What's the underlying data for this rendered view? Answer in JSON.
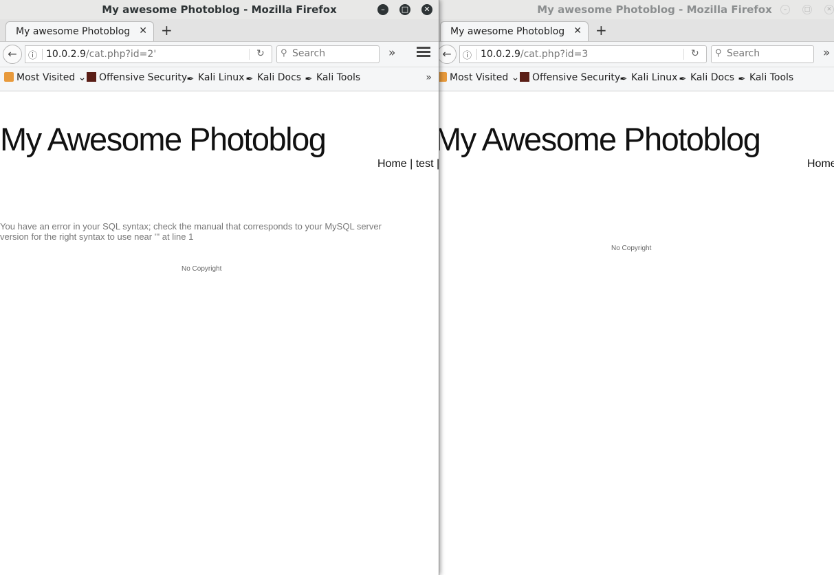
{
  "left": {
    "window_title": "My awesome Photoblog - Mozilla Firefox",
    "window_buttons": {
      "minimize": "–",
      "maximize": "□",
      "close": "✕"
    },
    "tab": {
      "label": "My awesome Photoblog",
      "close": "✕"
    },
    "new_tab": "+",
    "url": {
      "host": "10.0.2.9",
      "path": "/cat.php?id=2'"
    },
    "search_placeholder": "Search",
    "overflow": "»",
    "bookmarks": [
      {
        "label": "Most Visited",
        "icon": "folder-icon"
      },
      {
        "label": "Offensive Security",
        "icon": "offsec-icon"
      },
      {
        "label": "Kali Linux",
        "icon": "kali-icon"
      },
      {
        "label": "Kali Docs",
        "icon": "kali-icon"
      },
      {
        "label": "Kali Tools",
        "icon": "kali-icon"
      }
    ],
    "bookmarks_more": "»",
    "site_title": "My Awesome Photoblog",
    "nav": "Home |  test |",
    "sql_error": "You have an error in your SQL syntax; check the manual that corresponds to your MySQL server version for the right syntax to use near ''' at line 1",
    "footer": "No Copyright"
  },
  "right": {
    "window_title": "My awesome Photoblog - Mozilla Firefox",
    "window_buttons": {
      "minimize": "–",
      "maximize": "□",
      "close": "✕"
    },
    "tab": {
      "label": "My awesome Photoblog",
      "close": "✕"
    },
    "new_tab": "+",
    "url": {
      "host": "10.0.2.9",
      "path": "/cat.php?id=3"
    },
    "search_placeholder": "Search",
    "overflow": "»",
    "bookmarks": [
      {
        "label": "Most Visited",
        "icon": "folder-icon"
      },
      {
        "label": "Offensive Security",
        "icon": "offsec-icon"
      },
      {
        "label": "Kali Linux",
        "icon": "kali-icon"
      },
      {
        "label": "Kali Docs",
        "icon": "kali-icon"
      },
      {
        "label": "Kali Tools",
        "icon": "kali-icon"
      }
    ],
    "bookmarks_more": "»",
    "site_title": "My Awesome Photoblog",
    "nav": "Home",
    "footer": "No Copyright"
  },
  "colors": {
    "titlebar": "#e8e8e7",
    "toolbar": "#f5f6f7",
    "error_text": "#777777"
  }
}
